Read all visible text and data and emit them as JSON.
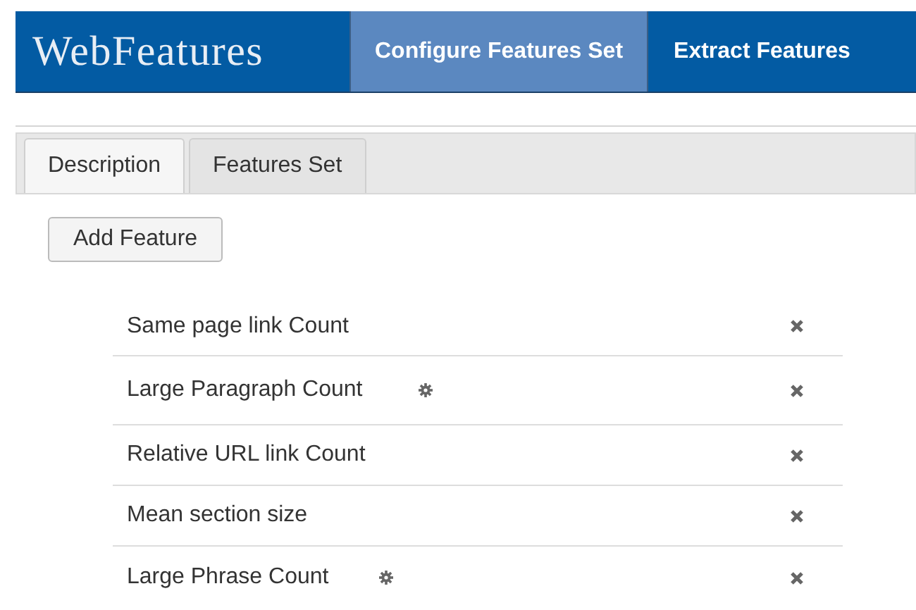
{
  "brand": "WebFeatures",
  "nav": [
    {
      "label": "Configure Features Set",
      "selected": true
    },
    {
      "label": "Extract Features",
      "selected": false
    }
  ],
  "tabs": [
    {
      "label": "Description",
      "selected": true
    },
    {
      "label": "Features Set",
      "selected": false
    }
  ],
  "add_button": "Add Feature",
  "features": [
    {
      "name": "Same page link Count",
      "configurable": false
    },
    {
      "name": "Large Paragraph Count",
      "configurable": true
    },
    {
      "name": "Relative URL link Count",
      "configurable": false
    },
    {
      "name": "Mean section size",
      "configurable": false
    },
    {
      "name": "Large Phrase Count",
      "configurable": true
    }
  ]
}
